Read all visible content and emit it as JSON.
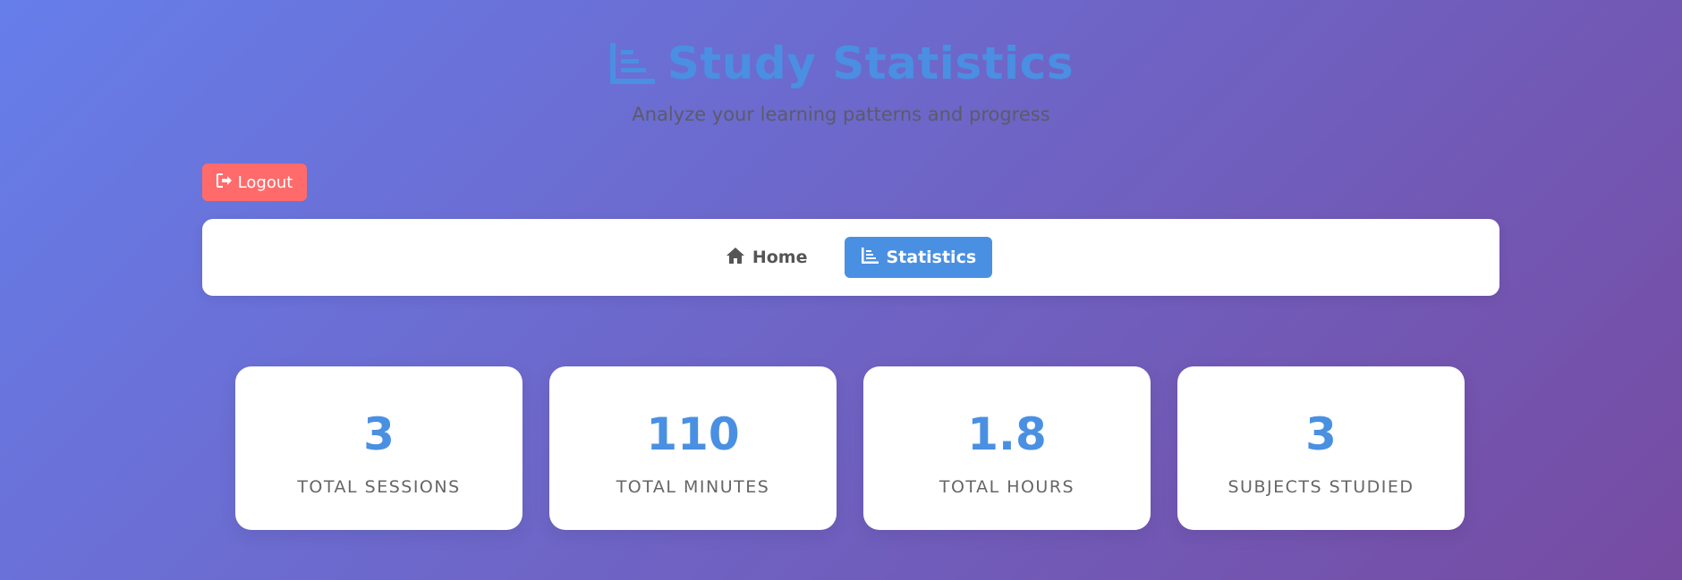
{
  "header": {
    "title": "Study Statistics",
    "subtitle": "Analyze your learning patterns and progress",
    "title_icon": "bar-chart-icon"
  },
  "logout": {
    "label": "Logout",
    "icon": "sign-out-icon",
    "color": "#ff6b6b"
  },
  "nav": {
    "items": [
      {
        "label": "Home",
        "icon": "home-icon",
        "active": false
      },
      {
        "label": "Statistics",
        "icon": "bar-chart-icon",
        "active": true
      }
    ]
  },
  "stats": [
    {
      "value": "3",
      "label": "TOTAL SESSIONS"
    },
    {
      "value": "110",
      "label": "TOTAL MINUTES"
    },
    {
      "value": "1.8",
      "label": "TOTAL HOURS"
    },
    {
      "value": "3",
      "label": "SUBJECTS STUDIED"
    }
  ],
  "colors": {
    "accent": "#4a90e2",
    "background_start": "#667eea",
    "background_end": "#764ba2"
  }
}
